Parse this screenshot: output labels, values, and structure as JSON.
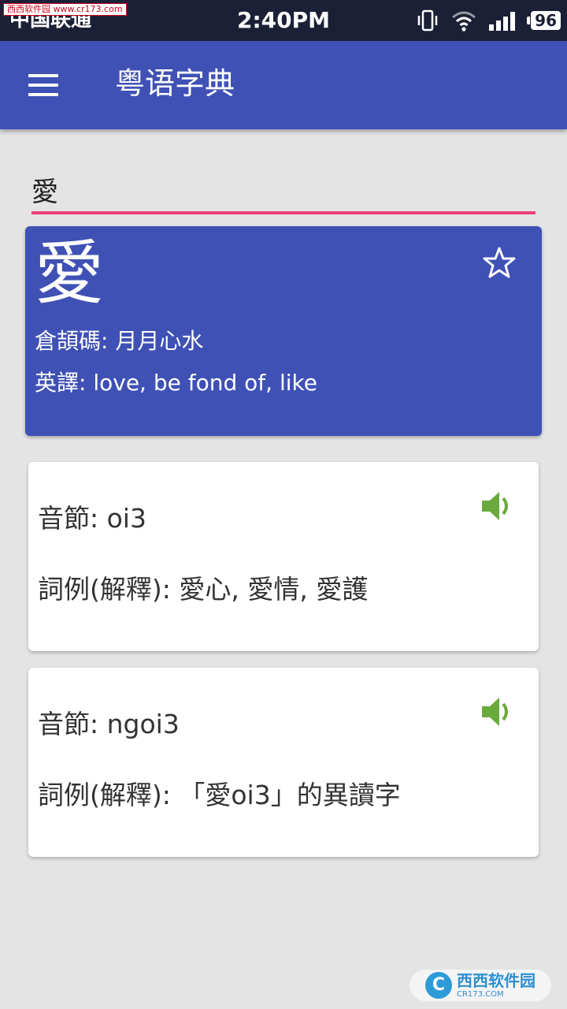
{
  "watermark_top": "西西软件园 www.cr173.com",
  "status_bar": {
    "carrier": "中国联通",
    "time": "2:40PM",
    "battery": "96"
  },
  "app_bar": {
    "title": "粤语字典",
    "menu_icon": "hamburger-menu-icon"
  },
  "search": {
    "value": "愛",
    "accent_color": "#ec407a"
  },
  "character": {
    "glyph": "愛",
    "cangjie": "倉頡碼: 月月心水",
    "english": "英譯: love, be fond of, like",
    "favorite_icon": "star-outline-icon"
  },
  "readings": [
    {
      "syllable": "音節: oi3",
      "example": "詞例(解釋): 愛心, 愛情, 愛護",
      "icon": "speaker-icon"
    },
    {
      "syllable": "音節: ngoi3",
      "example": "詞例(解釋): 「愛oi3」的異讀字",
      "icon": "speaker-icon"
    }
  ],
  "watermark_bottom": {
    "logo": "C",
    "text": "西西软件园",
    "sub": "CR173.COM"
  },
  "colors": {
    "primary": "#3f51b5",
    "status_bar": "#1c2036",
    "speaker": "#6aaa3c",
    "background": "#e4e4e4"
  }
}
